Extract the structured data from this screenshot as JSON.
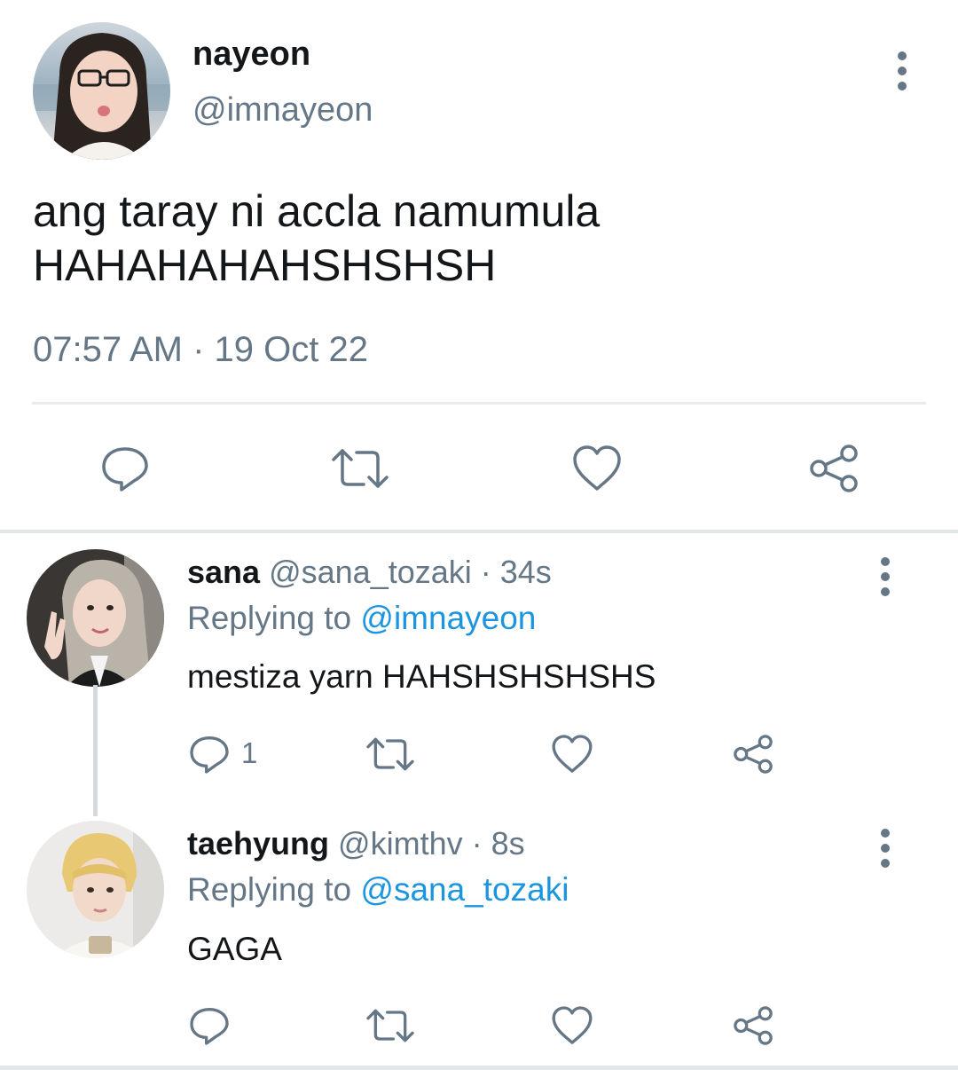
{
  "main_tweet": {
    "display_name": "nayeon",
    "handle": "@imnayeon",
    "text_line1": "ang taray ni accla namumula",
    "text_line2": "HAHAHAHAHSHSHSH",
    "timestamp": "07:57 AM · 19 Oct 22",
    "actions": [
      "reply-icon",
      "retweet-icon",
      "like-icon",
      "share-icon"
    ]
  },
  "replies": [
    {
      "display_name": "sana",
      "handle_time": "@sana_tozaki · 34s",
      "replying_prefix": "Replying to",
      "replying_to": "@imnayeon",
      "text": "mestiza yarn HAHSHSHSHSHS",
      "reply_count": "1"
    },
    {
      "display_name": "taehyung",
      "handle_time": "@kimthv · 8s",
      "replying_prefix": "Replying to",
      "replying_to": "@sana_tozaki",
      "text": "GAGA",
      "reply_count": ""
    }
  ],
  "colors": {
    "text_primary": "#14171a",
    "text_secondary": "#657786",
    "mention": "#1b95e0",
    "divider": "#e1e6ea"
  }
}
